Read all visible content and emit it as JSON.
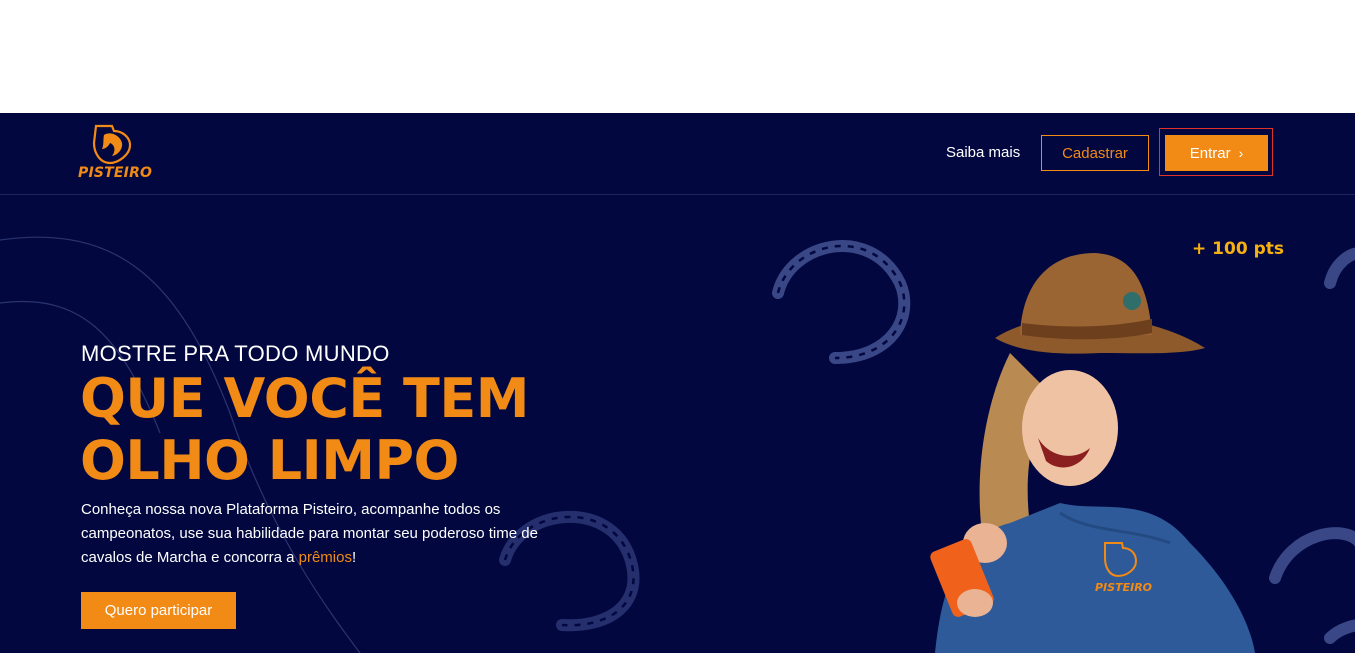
{
  "header": {
    "logo_text": "PISTEIRO",
    "nav_link": "Saiba mais",
    "register_button": "Cadastrar",
    "login_button": "Entrar",
    "login_chevron": "›"
  },
  "hero": {
    "eyebrow": "MOSTRE PRA TODO MUNDO",
    "headline_line1": "QUE VOCÊ TEM",
    "headline_line2": "OLHO LIMPO",
    "description_before": "Conheça nossa nova Plataforma Pisteiro, acompanhe todos os campeonatos, use sua habilidade para montar seu poderoso time de cavalos de Marcha e concorra a ",
    "description_highlight": "prêmios",
    "description_after": "!",
    "cta_button": "Quero participar",
    "points_badge": "+ 100 pts"
  },
  "icons": [
    "horse-shield-logo-icon",
    "horseshoe-icon",
    "chevron-right-icon"
  ],
  "colors": {
    "background": "#02083f",
    "accent": "#f28a16",
    "points": "#f6b00f",
    "focus_outline": "#e0322c"
  }
}
